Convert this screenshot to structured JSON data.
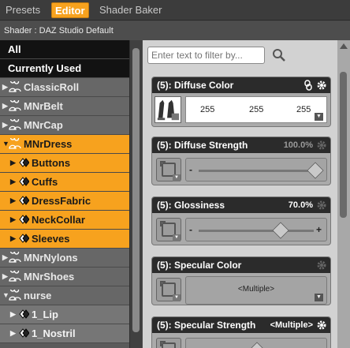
{
  "tabs": [
    {
      "label": "Presets",
      "active": false
    },
    {
      "label": "Editor",
      "active": true
    },
    {
      "label": "Shader Baker",
      "active": false
    }
  ],
  "shader_line": "Shader : DAZ Studio Default",
  "tree": {
    "all_label": "All",
    "current_label": "Currently Used",
    "items": [
      {
        "label": "ClassicRoll",
        "state": "collapsed",
        "level": 0,
        "style": "gray"
      },
      {
        "label": "MNrBelt",
        "state": "collapsed",
        "level": 0,
        "style": "gray"
      },
      {
        "label": "MNrCap",
        "state": "collapsed",
        "level": 0,
        "style": "gray"
      },
      {
        "label": "MNrDress",
        "state": "expanded",
        "level": 0,
        "style": "orange"
      },
      {
        "label": "Buttons",
        "state": "collapsed",
        "level": 1,
        "style": "orange"
      },
      {
        "label": "Cuffs",
        "state": "collapsed",
        "level": 1,
        "style": "orange"
      },
      {
        "label": "DressFabric",
        "state": "collapsed",
        "level": 1,
        "style": "orange"
      },
      {
        "label": "NeckCollar",
        "state": "collapsed",
        "level": 1,
        "style": "orange"
      },
      {
        "label": "Sleeves",
        "state": "collapsed",
        "level": 1,
        "style": "orange"
      },
      {
        "label": "MNrNylons",
        "state": "collapsed",
        "level": 0,
        "style": "gray"
      },
      {
        "label": "MNrShoes",
        "state": "collapsed",
        "level": 0,
        "style": "gray"
      },
      {
        "label": "nurse",
        "state": "expanded",
        "level": 0,
        "style": "gray"
      },
      {
        "label": "1_Lip",
        "state": "collapsed",
        "level": 1,
        "style": "lightgray"
      },
      {
        "label": "1_Nostril",
        "state": "collapsed",
        "level": 1,
        "style": "lightgray"
      }
    ]
  },
  "filter": {
    "placeholder": "Enter text to filter by..."
  },
  "properties": [
    {
      "title": "(5): Diffuse Color",
      "kind": "color",
      "values": [
        "255",
        "255",
        "255"
      ]
    },
    {
      "title": "(5): Diffuse Strength",
      "kind": "slider",
      "value_label": "100.0%",
      "value": 1.0,
      "dim": true
    },
    {
      "title": "(5): Glossiness",
      "kind": "slider",
      "value_label": "70.0%",
      "value": 0.7,
      "dim": false
    },
    {
      "title": "(5): Specular Color",
      "kind": "multiple",
      "multiple_label": "<Multiple>"
    },
    {
      "title": "(5): Specular Strength",
      "kind": "slider",
      "value_label": "<Multiple>",
      "value": 0.5,
      "dim": false
    }
  ],
  "colors": {
    "accent": "#f7a21e",
    "panel_dark": "#2b2b2b",
    "selected_bg": "#121212"
  }
}
